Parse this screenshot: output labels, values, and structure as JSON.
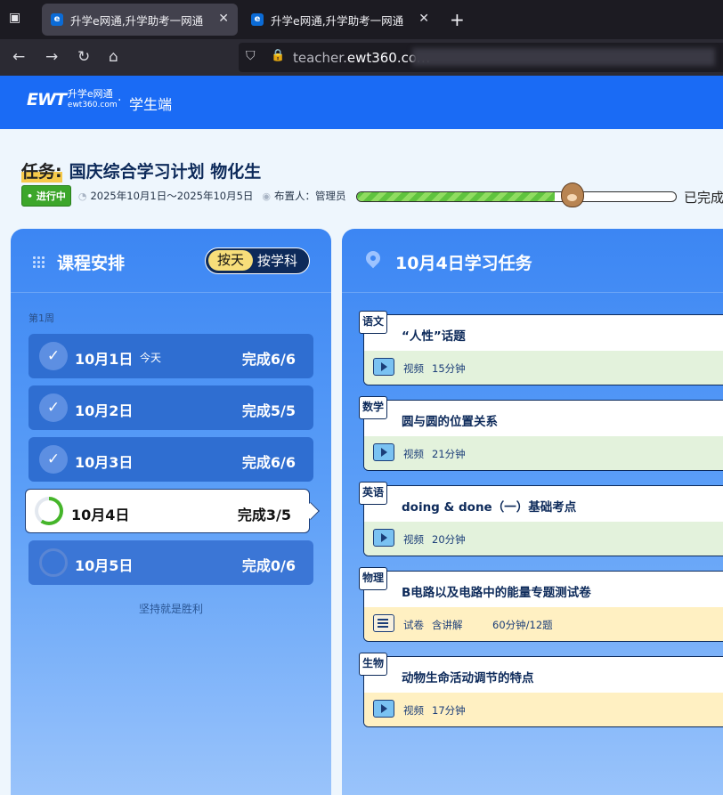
{
  "browser": {
    "tabs": [
      {
        "favicon": "e",
        "title": "升学e网通,升学助考一网通",
        "active": true
      },
      {
        "favicon": "e",
        "title": "升学e网通,升学助考一网通",
        "active": false
      }
    ],
    "url_domain": "teacher.",
    "url_rest": "ewt360.com",
    "icons": [
      "tab-overview-icon",
      "close-icon",
      "plus-icon",
      "back-icon",
      "forward-icon",
      "reload-icon",
      "home-icon",
      "shield-icon",
      "lock-icon"
    ]
  },
  "site": {
    "logo_main": "EWT",
    "logo_cn": "升学e网通",
    "logo_sub": "ewt360.com",
    "separator": "·",
    "role": "学生端"
  },
  "task": {
    "tag": "任务",
    "colon": ":",
    "name": "国庆综合学习计划 物化生",
    "status": "• 进行中",
    "date_range": "2025年10月1日～2025年10月5日",
    "assigner": "布置人：管理员",
    "progress_fraction": 0.62,
    "done_label": "已完成"
  },
  "schedule": {
    "title": "课程安排",
    "toggle_active": "按天",
    "toggle_inactive": "按学科",
    "week_label": "第1周",
    "days": [
      {
        "date": "10月1日",
        "today": "今天",
        "count": "完成6/6",
        "state": "done"
      },
      {
        "date": "10月2日",
        "today": "",
        "count": "完成5/5",
        "state": "done"
      },
      {
        "date": "10月3日",
        "today": "",
        "count": "完成6/6",
        "state": "done"
      },
      {
        "date": "10月4日",
        "today": "",
        "count": "完成3/5",
        "state": "current",
        "progress": 0.6
      },
      {
        "date": "10月5日",
        "today": "",
        "count": "完成0/6",
        "state": "future"
      }
    ],
    "motto": "坚持就是胜利"
  },
  "tasks": {
    "title": "10月4日学习任务",
    "items": [
      {
        "subject": "语文",
        "title": "“人性”话题",
        "kind": "视频",
        "extra": "",
        "duration": "15分钟",
        "bg": "green",
        "icon": "video-icon"
      },
      {
        "subject": "数学",
        "title": "圆与圆的位置关系",
        "kind": "视频",
        "extra": "",
        "duration": "21分钟",
        "bg": "green",
        "icon": "video-icon"
      },
      {
        "subject": "英语",
        "title": "doing & done（一）基础考点",
        "kind": "视频",
        "extra": "",
        "duration": "20分钟",
        "bg": "green",
        "icon": "video-icon"
      },
      {
        "subject": "物理",
        "title": "B电路以及电路中的能量专题测试卷",
        "kind": "试卷",
        "extra": "含讲解",
        "duration": "60分钟/12题",
        "bg": "yellow",
        "icon": "paper-icon"
      },
      {
        "subject": "生物",
        "title": "动物生命活动调节的特点",
        "kind": "视频",
        "extra": "",
        "duration": "17分钟",
        "bg": "yellow",
        "icon": "video-icon"
      }
    ]
  },
  "colors": {
    "brand": "#1a6bf5",
    "panel": "#3c86f3",
    "success": "#45b52a",
    "navy": "#0d2a5a"
  }
}
